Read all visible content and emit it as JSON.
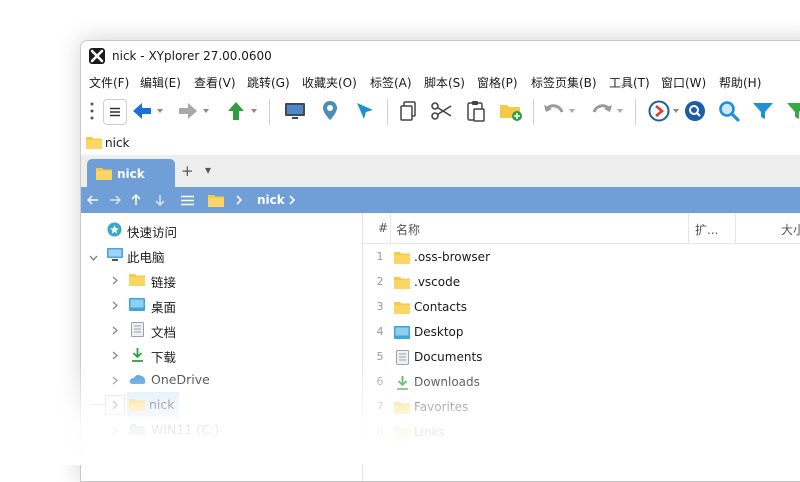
{
  "window": {
    "title": "nick - XYplorer 27.00.0600"
  },
  "menu": [
    "文件(F)",
    "编辑(E)",
    "查看(V)",
    "跳转(G)",
    "收藏夹(O)",
    "标签(A)",
    "脚本(S)",
    "窗格(P)",
    "标签页集(B)",
    "工具(T)",
    "窗口(W)",
    "帮助(H)"
  ],
  "toolbar": {
    "icons": [
      "drag-handle-icon",
      "main-menu-icon",
      "back-arrow-icon",
      "forward-arrow-icon",
      "up-arrow-icon",
      "computer-icon",
      "location-pin-icon",
      "cursor-arrow-icon",
      "copy-icon",
      "scissors-icon",
      "paste-icon",
      "new-folder-icon",
      "undo-icon",
      "redo-icon",
      "script-run-icon",
      "find-icon",
      "quick-search-icon",
      "filter-icon",
      "filter-green-icon"
    ]
  },
  "address": {
    "path": "nick"
  },
  "tabs": [
    {
      "label": "nick",
      "active": true
    }
  ],
  "tabstrip": {
    "add_label": "+",
    "menu_label": "▾"
  },
  "breadcrumb": {
    "current": "nick"
  },
  "tree": [
    {
      "label": "快速访问",
      "icon": "quick-access-icon",
      "level": 0
    },
    {
      "label": "此电脑",
      "icon": "this-pc-icon",
      "level": 0,
      "expanded": true
    },
    {
      "label": "链接",
      "icon": "folder-icon",
      "level": 1
    },
    {
      "label": "桌面",
      "icon": "desktop-icon",
      "level": 1
    },
    {
      "label": "文档",
      "icon": "documents-icon",
      "level": 1
    },
    {
      "label": "下载",
      "icon": "downloads-icon",
      "level": 1
    },
    {
      "label": "OneDrive",
      "icon": "onedrive-icon",
      "level": 1
    },
    {
      "label": "nick",
      "icon": "folder-icon",
      "level": 1,
      "selected": true
    },
    {
      "label": "WIN11 (C:)",
      "icon": "drive-icon",
      "level": 1
    }
  ],
  "columns": {
    "num": "#",
    "name": "名称",
    "ext": "扩...",
    "size": "大小"
  },
  "files": [
    {
      "num": "1",
      "name": ".oss-browser",
      "icon": "folder-icon"
    },
    {
      "num": "2",
      "name": ".vscode",
      "icon": "folder-icon"
    },
    {
      "num": "3",
      "name": "Contacts",
      "icon": "folder-icon"
    },
    {
      "num": "4",
      "name": "Desktop",
      "icon": "desktop-icon"
    },
    {
      "num": "5",
      "name": "Documents",
      "icon": "documents-icon"
    },
    {
      "num": "6",
      "name": "Downloads",
      "icon": "downloads-icon"
    },
    {
      "num": "7",
      "name": "Favorites",
      "icon": "folder-icon"
    },
    {
      "num": "8",
      "name": "Links",
      "icon": "folder-icon"
    }
  ],
  "colors": {
    "accent": "#6f9fd6",
    "folder": "#f7c948",
    "green": "#2e9e3e"
  }
}
